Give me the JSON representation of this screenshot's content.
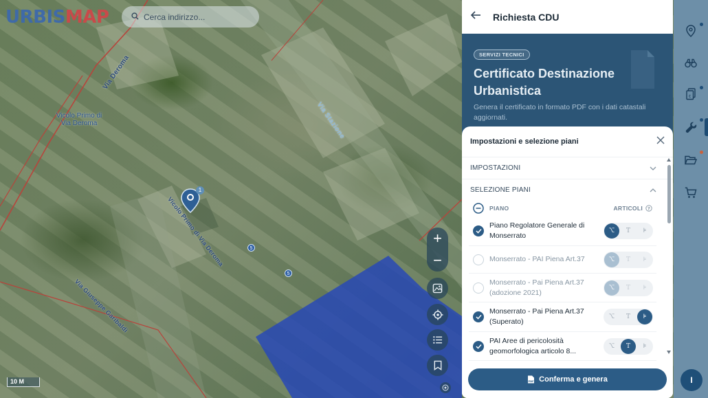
{
  "app": {
    "logo_part1": "URBIS",
    "logo_part2": "MAP"
  },
  "search": {
    "placeholder": "Cerca indirizzo..."
  },
  "map": {
    "streets": [
      "Via Deroma",
      "Vicolo Primo di Via Deroma",
      "Vicolo Primo di Via Deroma",
      "Via Stazione",
      "Via Giuseppe Garibaldi"
    ],
    "marker_count": "1",
    "dot_labels": [
      "5",
      "5"
    ],
    "scale": "10 M",
    "zoom_in": "+",
    "zoom_out": "−"
  },
  "panel": {
    "title": "Richiesta CDU",
    "hero": {
      "tag": "SERVIZI TECNICI",
      "heading": "Certificato Destinazione Urbanistica",
      "description": "Genera il certificato in formato PDF con i dati catastali aggiornati."
    },
    "sheet": {
      "title": "Impostazioni e selezione piani",
      "section_settings": "IMPOSTAZIONI",
      "section_plans": "SELEZIONE PIANI",
      "col_plan": "PIANO",
      "col_articles": "ARTICOLI",
      "plans": [
        {
          "label": "Piano Regolatore Generale di Monserrato",
          "checked": true,
          "mode": 0,
          "enabled": true
        },
        {
          "label": "Monserrato - PAI Piena Art.37",
          "checked": false,
          "mode": 0,
          "enabled": false
        },
        {
          "label": "Monserrato - Pai Piena Art.37 (adozione 2021)",
          "checked": false,
          "mode": 0,
          "enabled": false
        },
        {
          "label": "Monserrato - Pai Piena Art.37 (Superato)",
          "checked": true,
          "mode": 2,
          "enabled": true
        },
        {
          "label": "PAI Aree di pericolosità geomorfologica articolo 8...",
          "checked": true,
          "mode": 1,
          "enabled": true
        }
      ]
    },
    "cta": "Conferma e genera",
    "cta_icon_text": "PDF"
  },
  "user": {
    "initial": "I"
  },
  "colors": {
    "primary": "#2c5c86",
    "hero_bg": "#2c5576",
    "rail": "#6d8fa8",
    "blue_zone": "#2647b8"
  }
}
